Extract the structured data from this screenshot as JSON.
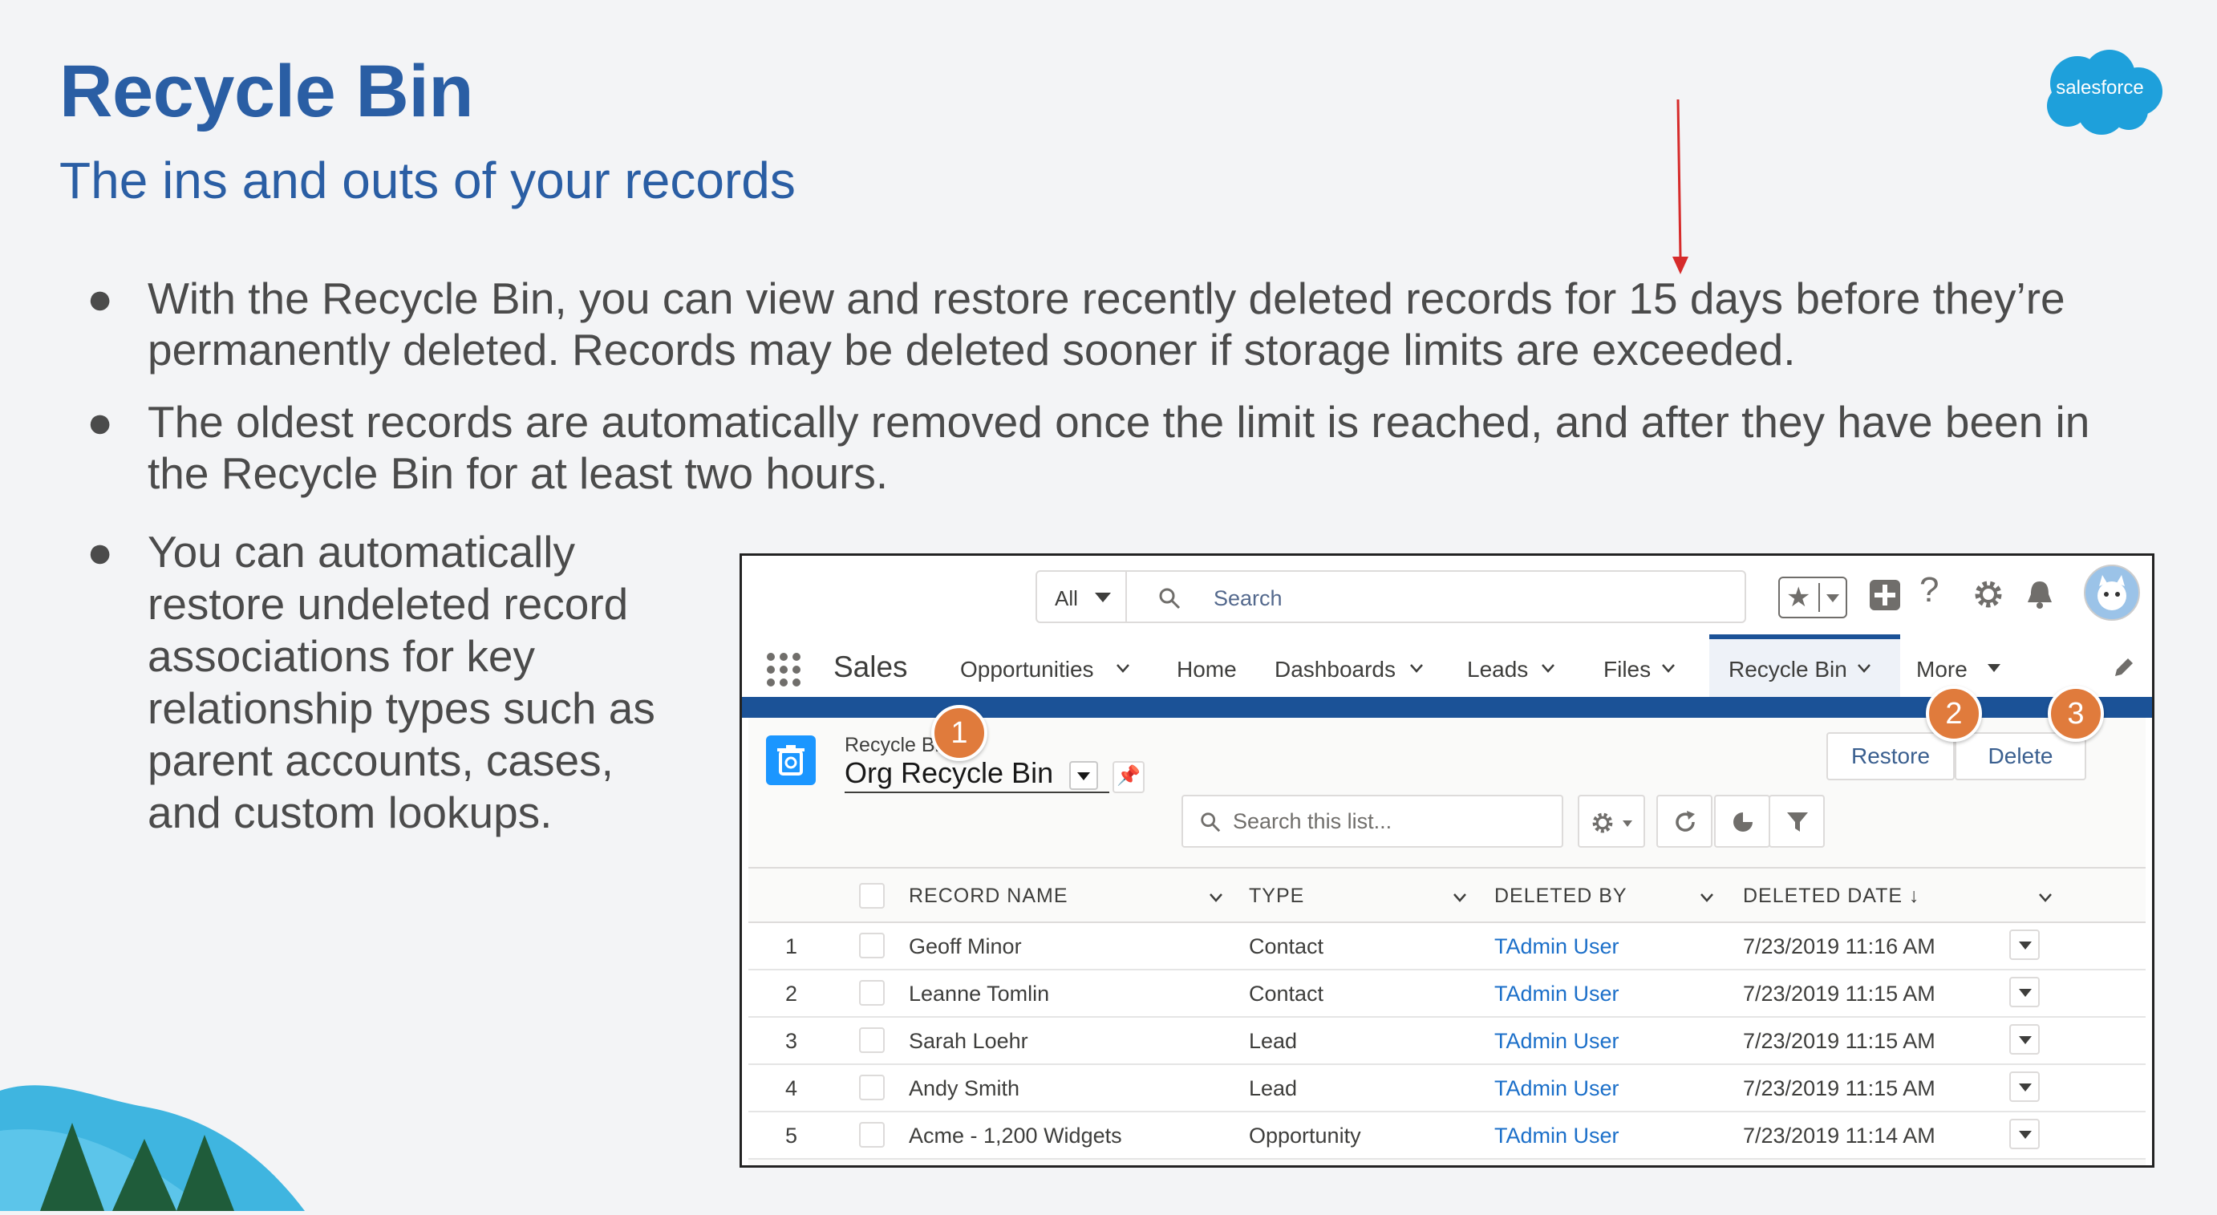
{
  "slide": {
    "title": "Recycle Bin",
    "subtitle": "The ins and outs of your records",
    "logo_text": "salesforce",
    "bullets": [
      {
        "line1": "With the Recycle Bin, you can view and restore recently deleted records for 15 days before they’re",
        "line2": "permanently deleted. Records may be deleted sooner if storage limits are exceeded."
      },
      {
        "line1": "The oldest records are automatically removed once the limit is reached, and after they have been in",
        "line2": "the Recycle Bin for at least two hours."
      },
      {
        "lines": [
          "You can automatically",
          "restore undeleted record",
          "associations for key",
          "relationship types such as",
          "parent accounts, cases,",
          "and custom lookups."
        ]
      }
    ],
    "bullet_glyph": "●"
  },
  "app": {
    "search_scope": "All",
    "search_placeholder": "Search",
    "app_name": "Sales",
    "nav": [
      "Opportunities",
      "Home",
      "Dashboards",
      "Leads",
      "Files",
      "Recycle Bin",
      "More"
    ],
    "active_nav": "Recycle Bin",
    "breadcrumb": "Recycle Bin",
    "list_view": "Org Recycle Bin",
    "buttons": {
      "restore": "Restore",
      "delete": "Delete"
    },
    "list_search_placeholder": "Search this list...",
    "badges": [
      "1",
      "2",
      "3"
    ],
    "columns": {
      "record_name": "RECORD NAME",
      "type": "TYPE",
      "deleted_by": "DELETED BY",
      "deleted_date": "DELETED DATE ↓"
    },
    "rows": [
      {
        "num": "1",
        "name": "Geoff Minor",
        "type": "Contact",
        "by": "TAdmin User",
        "date": "7/23/2019 11:16 AM"
      },
      {
        "num": "2",
        "name": "Leanne Tomlin",
        "type": "Contact",
        "by": "TAdmin User",
        "date": "7/23/2019 11:15 AM"
      },
      {
        "num": "3",
        "name": "Sarah Loehr",
        "type": "Lead",
        "by": "TAdmin User",
        "date": "7/23/2019 11:15 AM"
      },
      {
        "num": "4",
        "name": "Andy Smith",
        "type": "Lead",
        "by": "TAdmin User",
        "date": "7/23/2019 11:15 AM"
      },
      {
        "num": "5",
        "name": "Acme - 1,200 Widgets",
        "type": "Opportunity",
        "by": "TAdmin User",
        "date": "7/23/2019 11:14 AM"
      }
    ]
  },
  "colors": {
    "title": "#2a5ea4",
    "brand_blue": "#1b5297",
    "badge_orange": "#e07b3c",
    "arrow_red": "#d62b2b",
    "link": "#1b6fc9"
  }
}
